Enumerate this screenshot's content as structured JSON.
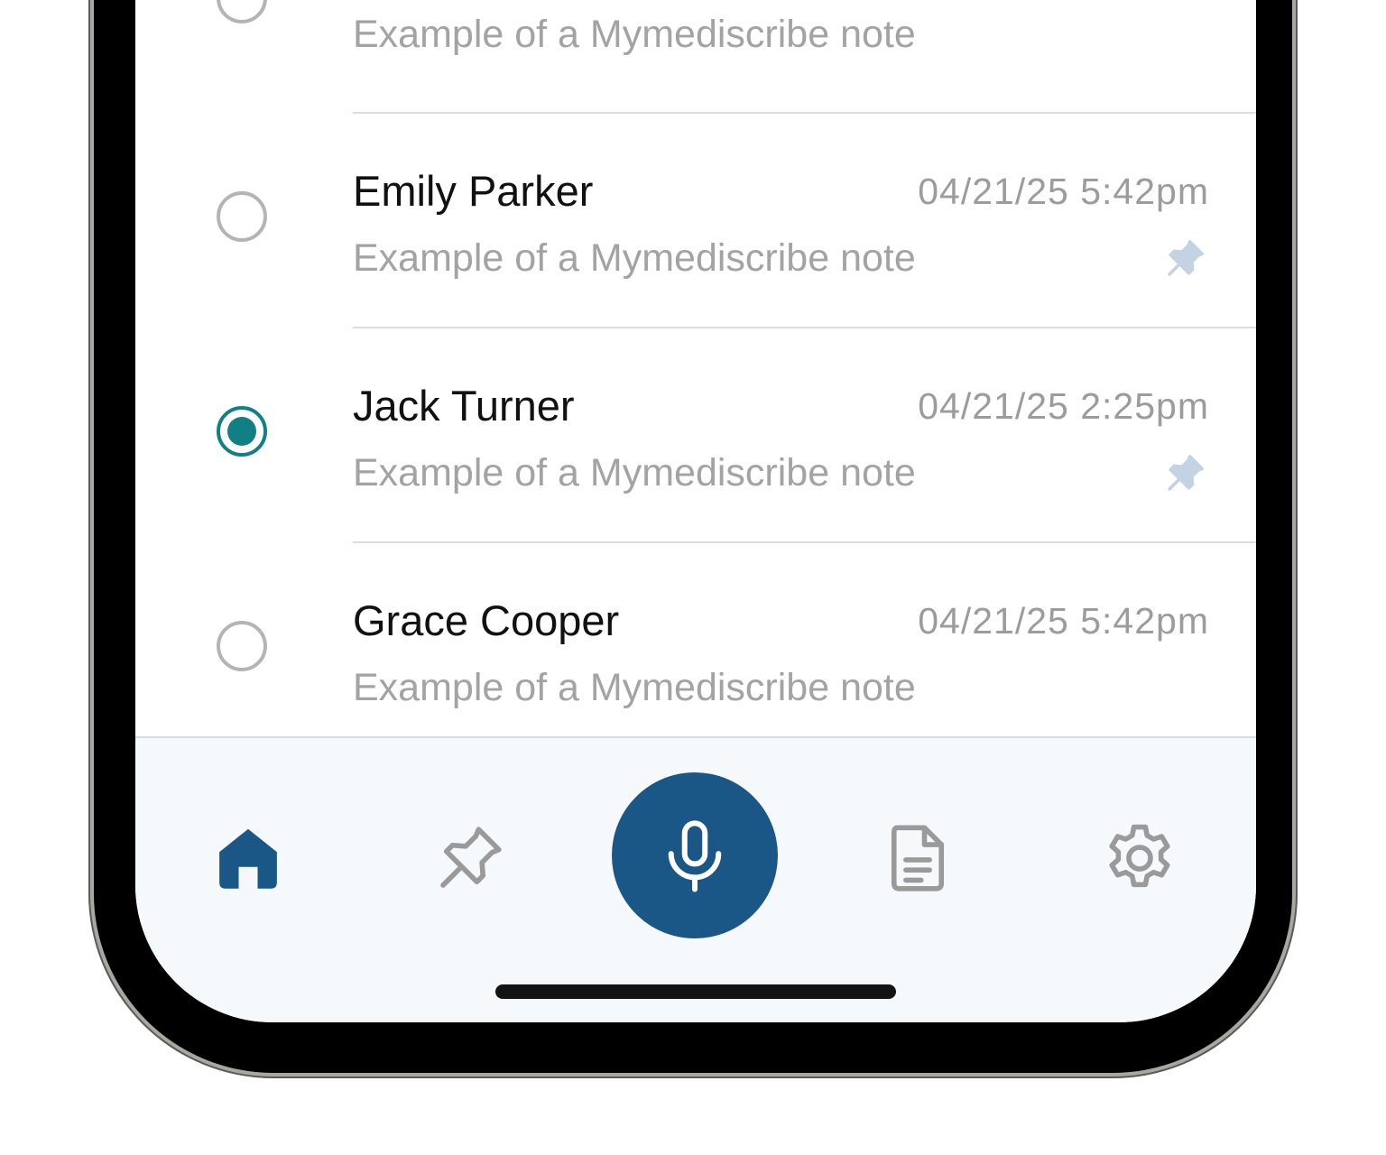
{
  "notes": [
    {
      "name": "",
      "date": "",
      "preview": "Example of a Mymediscribe note",
      "selected": false,
      "pinned": false
    },
    {
      "name": "Emily Parker",
      "date": "04/21/25 5:42pm",
      "preview": "Example of a Mymediscribe note",
      "selected": false,
      "pinned": true
    },
    {
      "name": "Jack Turner",
      "date": "04/21/25 2:25pm",
      "preview": "Example of a Mymediscribe note",
      "selected": true,
      "pinned": true
    },
    {
      "name": "Grace Cooper",
      "date": "04/21/25 5:42pm",
      "preview": "Example of a Mymediscribe note",
      "selected": false,
      "pinned": false
    }
  ],
  "tabbar": {
    "items": [
      {
        "icon": "home-icon",
        "active": true
      },
      {
        "icon": "pin-icon",
        "active": false
      },
      {
        "icon": "microphone-icon",
        "active": false
      },
      {
        "icon": "document-icon",
        "active": false
      },
      {
        "icon": "gear-icon",
        "active": false
      }
    ]
  },
  "colors": {
    "accent": "#1a5686",
    "selected_radio": "#118084",
    "pin": "#c3d3e3",
    "inactive_icon": "#9a9a9a"
  }
}
